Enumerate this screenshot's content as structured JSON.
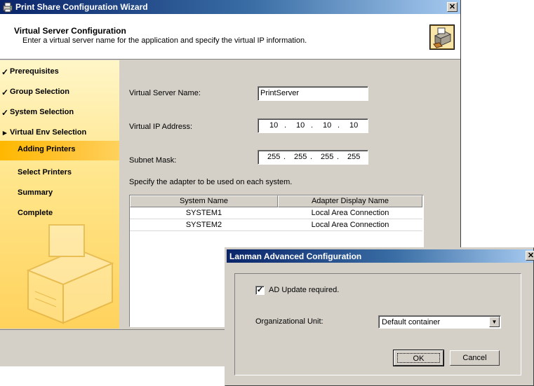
{
  "wizard": {
    "title": "Print Share Configuration Wizard",
    "header": {
      "title": "Virtual Server Configuration",
      "subtitle": "Enter a virtual server name for the application and specify the virtual IP information."
    },
    "sidebar": {
      "items": [
        {
          "label": "Prerequisites",
          "mark": "✓"
        },
        {
          "label": "Group Selection",
          "mark": "✓"
        },
        {
          "label": "System Selection",
          "mark": "✓"
        },
        {
          "label": "Virtual Env Selection",
          "mark": "▸"
        },
        {
          "label": "Adding Printers",
          "mark": ""
        },
        {
          "label": "Select Printers",
          "mark": ""
        },
        {
          "label": "Summary",
          "mark": ""
        },
        {
          "label": "Complete",
          "mark": ""
        }
      ]
    },
    "form": {
      "server_name_label": "Virtual Server Name:",
      "server_name_value": "PrintServer",
      "ip_label": "Virtual IP Address:",
      "ip_octets": [
        "10",
        "10",
        "10",
        "10"
      ],
      "mask_label": "Subnet Mask:",
      "mask_octets": [
        "255",
        "255",
        "255",
        "255"
      ],
      "adapter_instruction": "Specify the adapter to be used on each system."
    },
    "table": {
      "headers": [
        "System Name",
        "Adapter Display Name"
      ],
      "rows": [
        [
          "SYSTEM1",
          "Local Area Connection"
        ],
        [
          "SYSTEM2",
          "Local Area Connection"
        ]
      ]
    }
  },
  "dialog": {
    "title": "Lanman Advanced Configuration",
    "ad_update_label": "AD Update required.",
    "ad_update_checked": true,
    "ou_label": "Organizational Unit:",
    "ou_value": "Default container",
    "ok_label": "OK",
    "cancel_label": "Cancel"
  }
}
